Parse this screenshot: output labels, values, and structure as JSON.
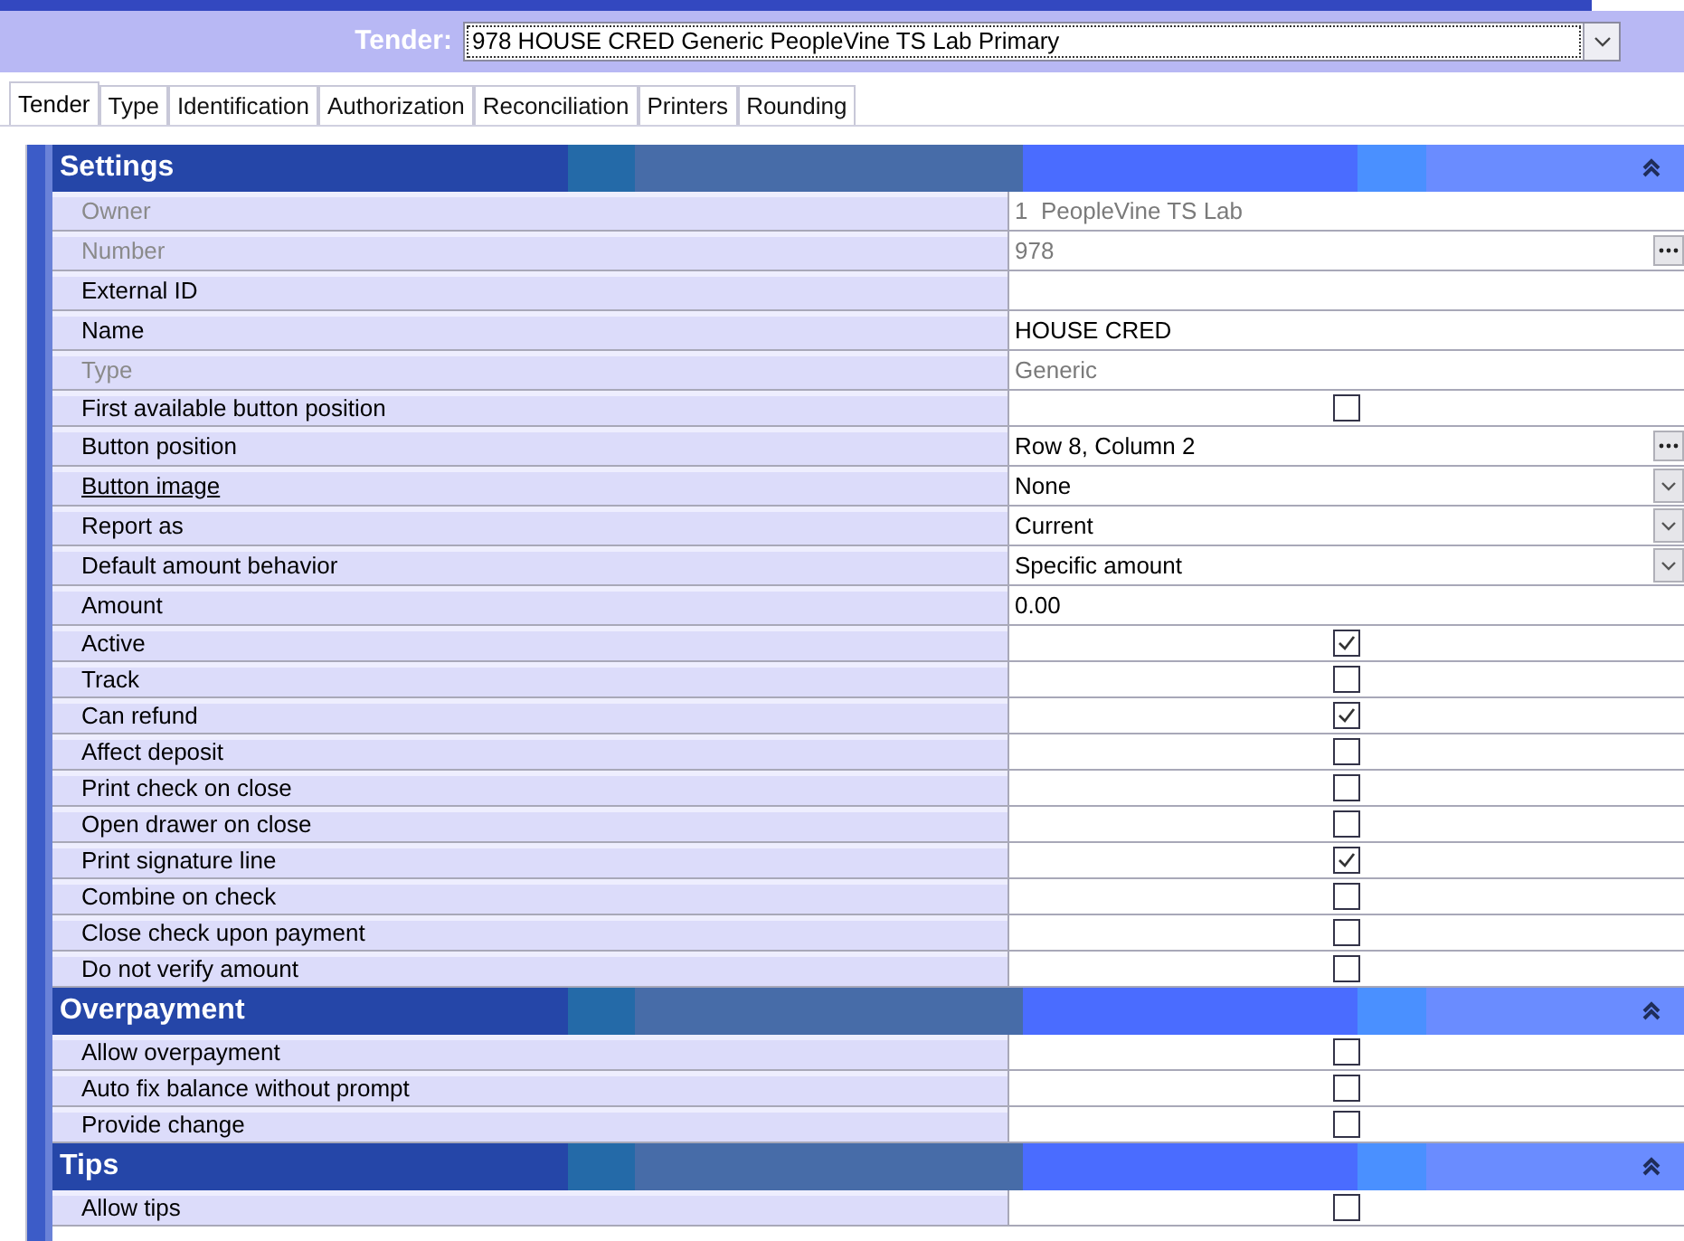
{
  "header": {
    "label": "Tender:",
    "value": "978 HOUSE CRED Generic PeopleVine TS Lab Primary"
  },
  "tabs": [
    {
      "label": "Tender",
      "selected": true
    },
    {
      "label": "Type",
      "selected": false
    },
    {
      "label": "Identification",
      "selected": false
    },
    {
      "label": "Authorization",
      "selected": false
    },
    {
      "label": "Reconciliation",
      "selected": false
    },
    {
      "label": "Printers",
      "selected": false
    },
    {
      "label": "Rounding",
      "selected": false
    }
  ],
  "sections": [
    {
      "title": "Settings",
      "expanded": true,
      "rows": [
        {
          "label": "Owner",
          "kind": "text",
          "value": "1  PeopleVine TS Lab",
          "disabled": true
        },
        {
          "label": "Number",
          "kind": "ellipsis",
          "value": "978",
          "disabled": true
        },
        {
          "label": "External ID",
          "kind": "text",
          "disabled": false
        },
        {
          "label": "Name",
          "kind": "text",
          "value": "HOUSE CRED",
          "disabled": false
        },
        {
          "label": "Type",
          "kind": "text",
          "value": "Generic",
          "disabled": true
        },
        {
          "label": "First available button position",
          "kind": "checkbox",
          "checked": false,
          "disabled": false
        },
        {
          "label": "Button position",
          "kind": "ellipsis",
          "value": "Row 8, Column 2",
          "disabled": false
        },
        {
          "label": "Button image",
          "kind": "dropdown",
          "value": "None",
          "disabled": false,
          "underlined": true
        },
        {
          "label": "Report as",
          "kind": "dropdown",
          "value": "Current",
          "disabled": false
        },
        {
          "label": "Default amount behavior",
          "kind": "dropdown",
          "value": "Specific amount",
          "disabled": false
        },
        {
          "label": "Amount",
          "kind": "text",
          "value": "0.00",
          "disabled": false
        },
        {
          "label": "Active",
          "kind": "checkbox",
          "checked": true,
          "disabled": false
        },
        {
          "label": "Track",
          "kind": "checkbox",
          "checked": false,
          "disabled": false
        },
        {
          "label": "Can refund",
          "kind": "checkbox",
          "checked": true,
          "disabled": false
        },
        {
          "label": "Affect deposit",
          "kind": "checkbox",
          "checked": false,
          "disabled": false
        },
        {
          "label": "Print check on close",
          "kind": "checkbox",
          "checked": false,
          "disabled": false
        },
        {
          "label": "Open drawer on close",
          "kind": "checkbox",
          "checked": false,
          "disabled": false
        },
        {
          "label": "Print signature line",
          "kind": "checkbox",
          "checked": true,
          "disabled": false
        },
        {
          "label": "Combine on check",
          "kind": "checkbox",
          "checked": false,
          "disabled": false
        },
        {
          "label": "Close check upon payment",
          "kind": "checkbox",
          "checked": false,
          "disabled": false
        },
        {
          "label": "Do not verify amount",
          "kind": "checkbox",
          "checked": false,
          "disabled": false
        }
      ]
    },
    {
      "title": "Overpayment",
      "expanded": true,
      "rows": [
        {
          "label": "Allow overpayment",
          "kind": "checkbox",
          "checked": false,
          "disabled": false
        },
        {
          "label": "Auto fix balance without prompt",
          "kind": "checkbox",
          "checked": false,
          "disabled": false
        },
        {
          "label": "Provide change",
          "kind": "checkbox",
          "checked": false,
          "disabled": false
        }
      ]
    },
    {
      "title": "Tips",
      "expanded": true,
      "rows": [
        {
          "label": "Allow tips",
          "kind": "checkbox",
          "checked": false,
          "disabled": false
        }
      ]
    }
  ]
}
